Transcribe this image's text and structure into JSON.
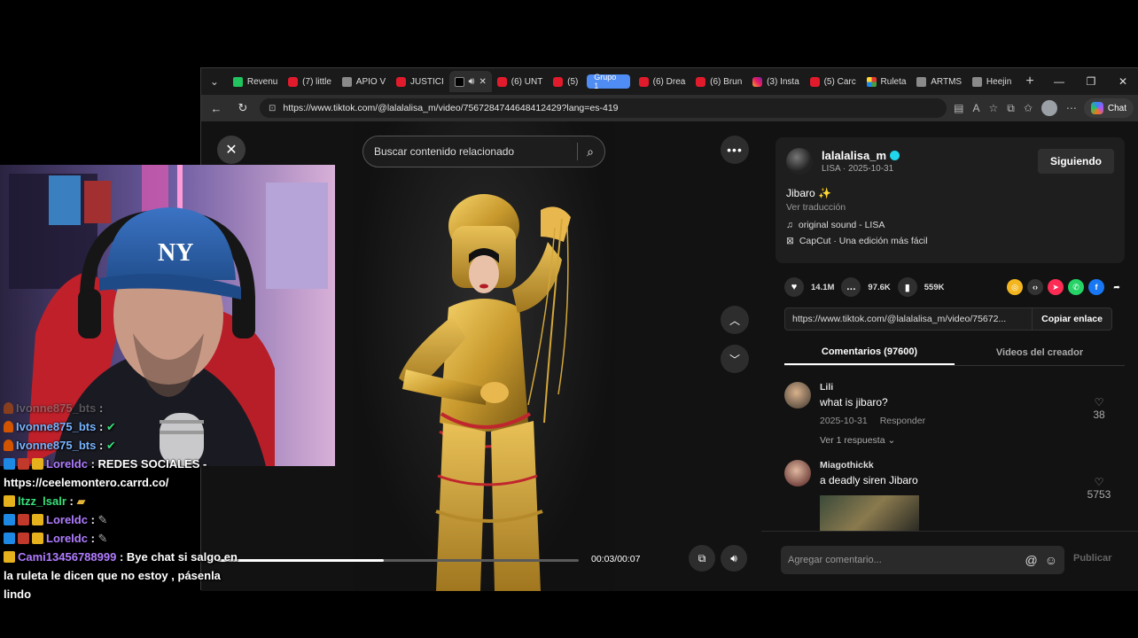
{
  "browser": {
    "tabs": [
      {
        "label": "Revenu",
        "icon": "green-k-icon",
        "active": false
      },
      {
        "label": "(7) little",
        "icon": "youtube-icon",
        "active": false
      },
      {
        "label": "APIO V",
        "icon": "generic-icon",
        "active": false
      },
      {
        "label": "JUSTICI",
        "icon": "youtube-icon",
        "active": false
      },
      {
        "label": "",
        "icon": "tiktok-icon",
        "active": true
      },
      {
        "label": "(6) UNT",
        "icon": "youtube-icon",
        "active": false
      },
      {
        "label": "(5)",
        "icon": "youtube-icon",
        "active": false
      },
      {
        "label": "(6) Drea",
        "icon": "youtube-icon",
        "active": false
      },
      {
        "label": "(6) Brun",
        "icon": "youtube-icon",
        "active": false
      },
      {
        "label": "(3) Insta",
        "icon": "instagram-icon",
        "active": false
      },
      {
        "label": "(5) Carc",
        "icon": "youtube-icon",
        "active": false
      },
      {
        "label": "Ruleta",
        "icon": "multicolor-icon",
        "active": false
      },
      {
        "label": "ARTMS",
        "icon": "generic-icon",
        "active": false
      },
      {
        "label": "Heejin",
        "icon": "gray-icon",
        "active": false
      }
    ],
    "group_label": "Grupo 1",
    "url": "https://www.tiktok.com/@lalalalisa_m/video/7567284744648412429?lang=es-419",
    "copilot_label": "Chat"
  },
  "video": {
    "search_placeholder": "Buscar contenido relacionado",
    "time": "00:03/00:07",
    "progress_fraction": 0.46
  },
  "creator": {
    "username": "lalalalisa_m",
    "subline": "LISA · 2025-10-31",
    "follow_label": "Siguiendo",
    "caption": "Jibaro ✨",
    "see_translation": "Ver traducción",
    "sound": "original sound - LISA",
    "capcut": "CapCut · Una edición más fácil"
  },
  "stats": {
    "likes": "14.1M",
    "comments": "97.6K",
    "saves": "559K"
  },
  "share_link": {
    "url": "https://www.tiktok.com/@lalalalisa_m/video/75672...",
    "copy_label": "Copiar enlace"
  },
  "tabs": {
    "comments": "Comentarios (97600)",
    "creator_videos": "Videos del creador"
  },
  "comments": [
    {
      "user": "Lili",
      "text": "what is jibaro?",
      "date": "2025-10-31",
      "reply": "Responder",
      "likes": "38",
      "replies": "Ver 1 respuesta ⌄"
    },
    {
      "user": "Miagothickk",
      "text": "a deadly siren Jibaro",
      "likes": "5753"
    }
  ],
  "comment_input": {
    "placeholder": "Agregar comentario...",
    "publish": "Publicar"
  },
  "chat": [
    {
      "user": "Ivonne875_bts",
      "sep": " :",
      "msg": ""
    },
    {
      "user": "Ivonne875_bts",
      "sep": " :",
      "msg": ""
    },
    {
      "user": "Ivonne875_bts",
      "sep": " :",
      "msg": ""
    },
    {
      "user": "Loreldc",
      "sep": " : ",
      "msg": "REDES SOCIALES - https://ceelemontero.carrd.co/"
    },
    {
      "user": "ltzz_lsalr",
      "sep": " :",
      "msg": ""
    },
    {
      "user": "Loreldc",
      "sep": " :",
      "msg": ""
    },
    {
      "user": "Loreldc",
      "sep": " :",
      "msg": ""
    },
    {
      "user": "Cami13456788999",
      "sep": " : ",
      "msg": "Bye chat si salgo en la ruleta le dicen que no estoy , pásenla lindo"
    }
  ],
  "webcam": {
    "cap_logo": "NY"
  },
  "colors": {
    "tiktok_bg": "#121212",
    "verified": "#20d5ec",
    "group_blue": "#4f8cf3"
  }
}
